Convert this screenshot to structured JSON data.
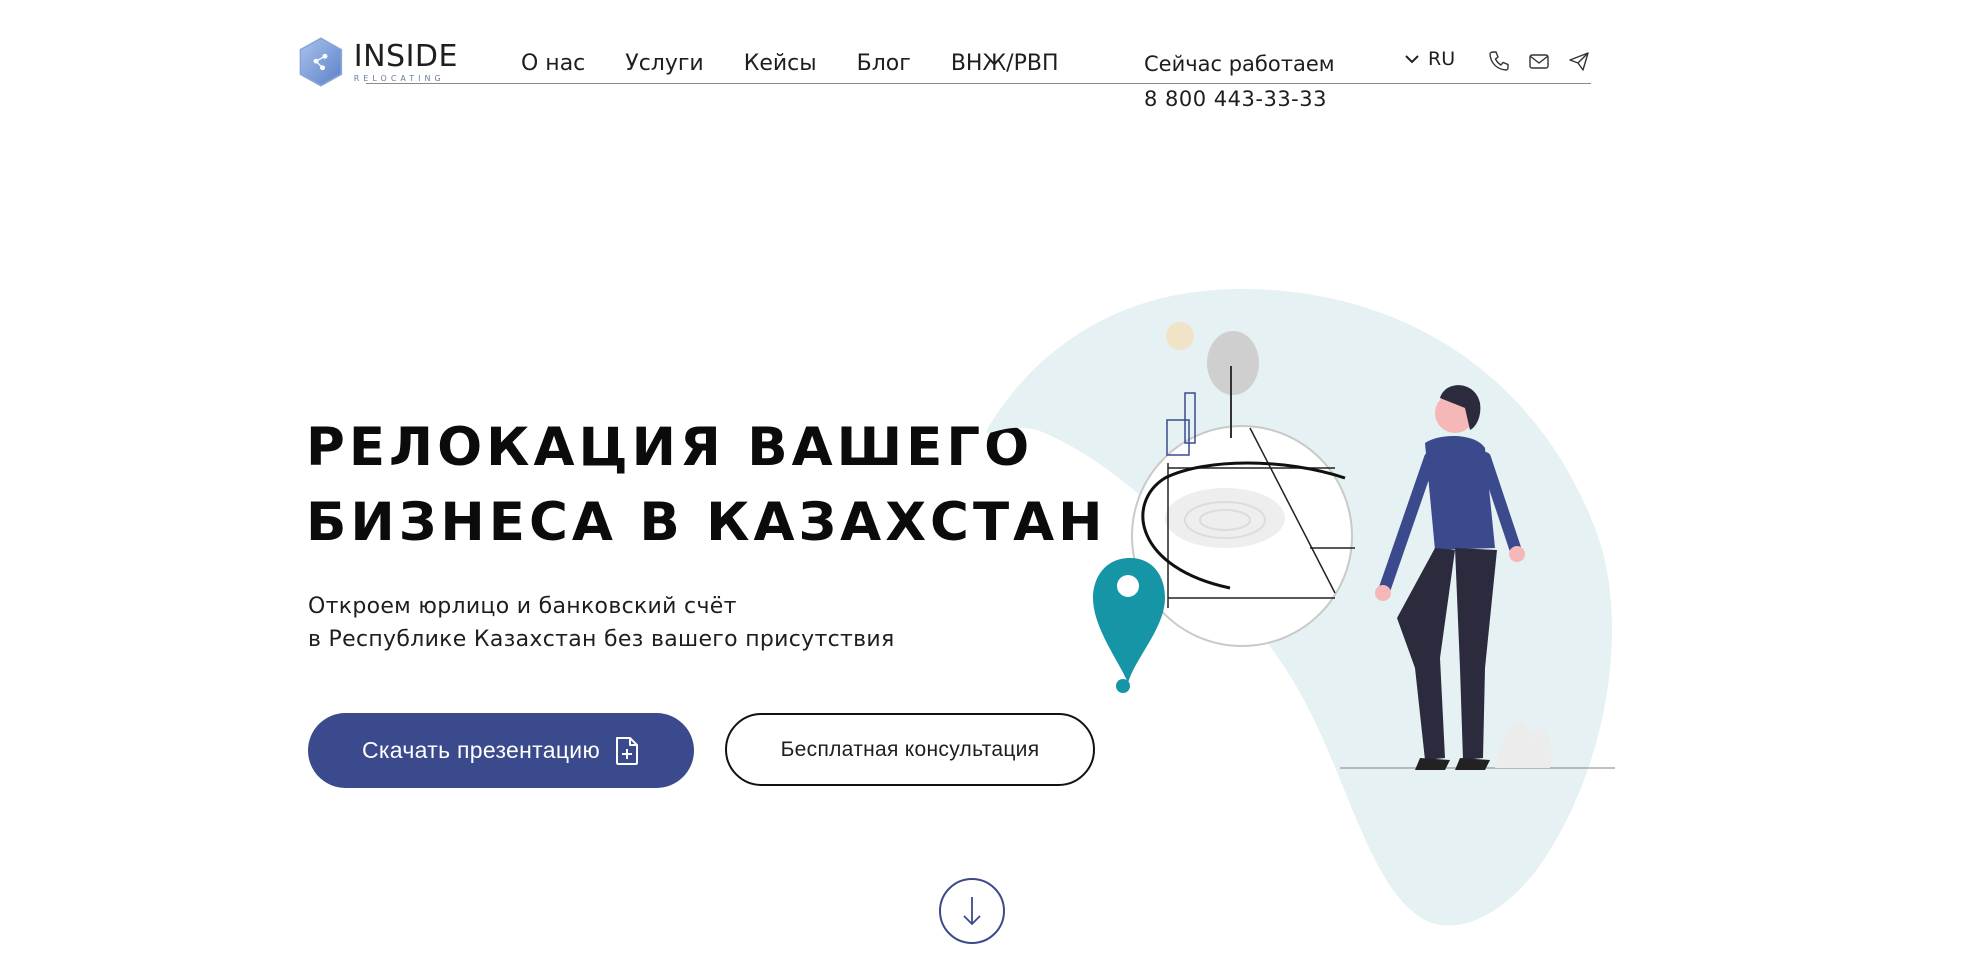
{
  "header": {
    "logo_word": "INSIDE",
    "logo_sub": "RELOCATING",
    "nav": [
      "О нас",
      "Услуги",
      "Кейсы",
      "Блог",
      "ВНЖ/РВП"
    ],
    "status": "Сейчас работаем",
    "phone": "8 800 443-33-33",
    "language": "RU"
  },
  "hero": {
    "title_line1": "РЕЛОКАЦИЯ ВАШЕГО",
    "title_line2": "БИЗНЕСА В КАЗАХСТАН",
    "subtitle_line1": "Откроем юрлицо и банковский счёт",
    "subtitle_line2": "в Республике Казахстан без вашего присутствия",
    "primary_button": "Скачать презентацию",
    "secondary_button": "Бесплатная консультация"
  },
  "colors": {
    "accent": "#3b4a8d",
    "blob": "#e5f1f2",
    "pin": "#1595a6"
  },
  "icons": [
    "logo-hexagon-icon",
    "chevron-down-icon",
    "phone-icon",
    "mail-icon",
    "telegram-icon",
    "document-plus-icon",
    "arrow-down-icon"
  ]
}
